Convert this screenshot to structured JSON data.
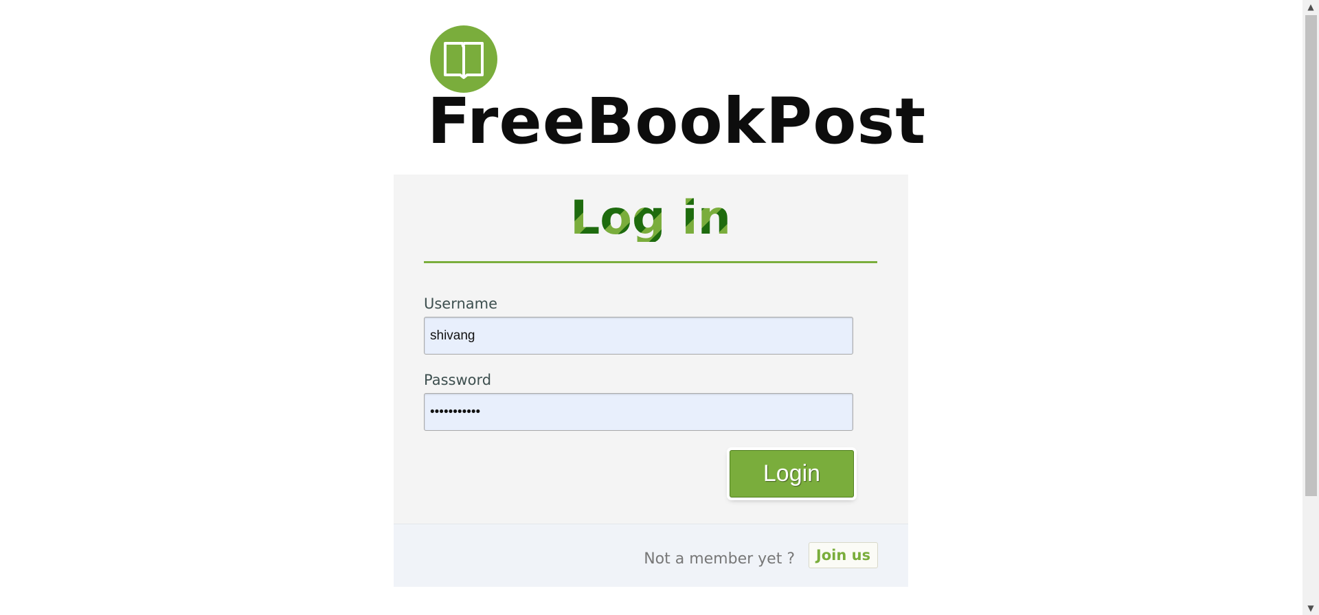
{
  "brand": {
    "name": "FreeBookPost",
    "logo_icon": "open-book-icon",
    "colors": {
      "accent": "#7aad3c",
      "accent_dark": "#1e6b0e",
      "text": "#0d0d0d"
    }
  },
  "login": {
    "title": "Log in",
    "username_label": "Username",
    "username_value": "shivang",
    "password_label": "Password",
    "password_value": "•••••••••••",
    "submit_label": "Login"
  },
  "footer": {
    "prompt": "Not a member yet ?",
    "join_label": "Join us"
  },
  "scrollbar": {
    "up_icon": "scroll-up-arrow",
    "down_icon": "scroll-down-arrow"
  }
}
